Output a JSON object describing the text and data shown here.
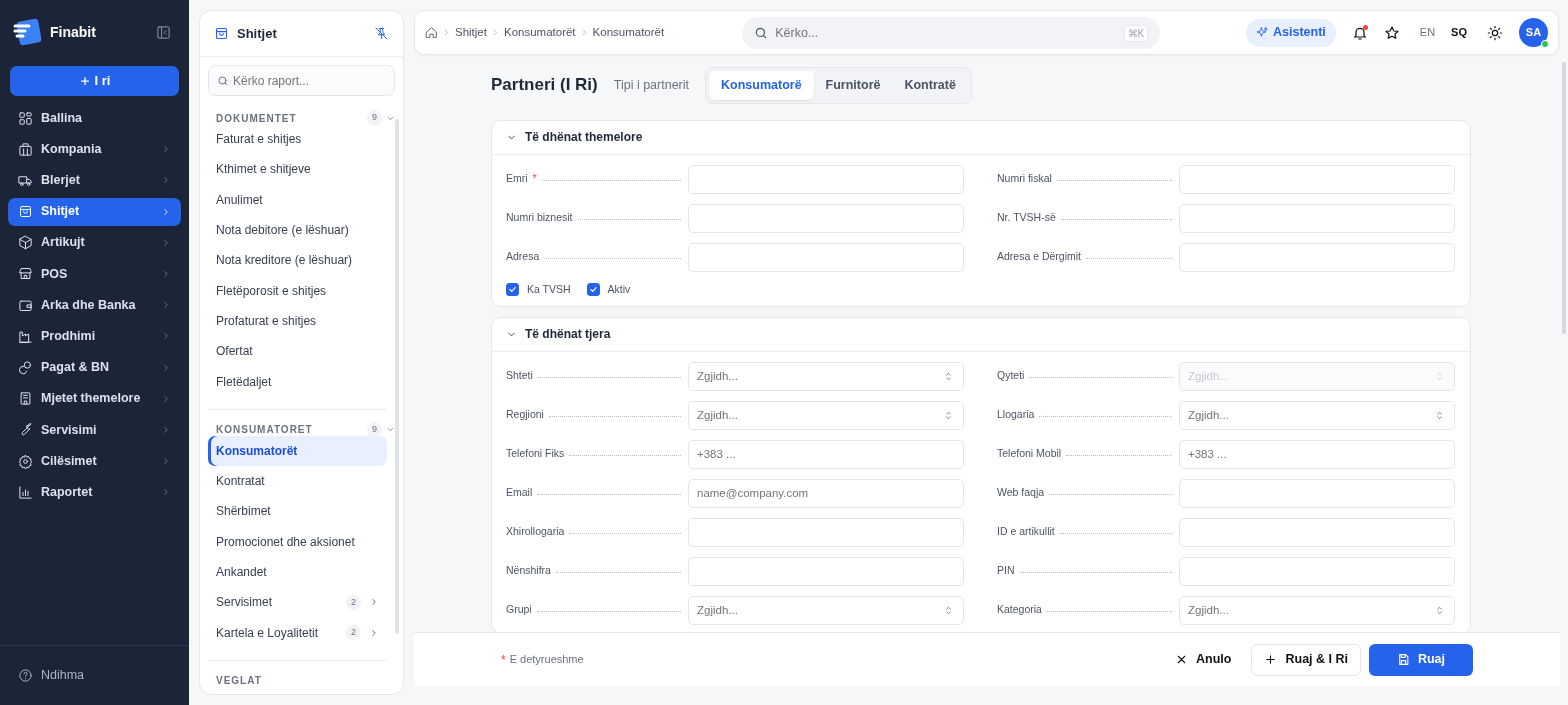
{
  "brand": {
    "name": "Finabit"
  },
  "new_button": {
    "label": "I ri"
  },
  "sidebar": {
    "items": [
      {
        "label": "Ballina",
        "selected": false,
        "has_submenu": false
      },
      {
        "label": "Kompania",
        "selected": false,
        "has_submenu": true
      },
      {
        "label": "Blerjet",
        "selected": false,
        "has_submenu": true
      },
      {
        "label": "Shitjet",
        "selected": true,
        "has_submenu": true
      },
      {
        "label": "Artikujt",
        "selected": false,
        "has_submenu": true
      },
      {
        "label": "POS",
        "selected": false,
        "has_submenu": true
      },
      {
        "label": "Arka dhe Banka",
        "selected": false,
        "has_submenu": true
      },
      {
        "label": "Prodhimi",
        "selected": false,
        "has_submenu": true
      },
      {
        "label": "Pagat & BN",
        "selected": false,
        "has_submenu": true
      },
      {
        "label": "Mjetet themelore",
        "selected": false,
        "has_submenu": true
      },
      {
        "label": "Servisimi",
        "selected": false,
        "has_submenu": true
      },
      {
        "label": "Cilësimet",
        "selected": false,
        "has_submenu": true
      },
      {
        "label": "Raportet",
        "selected": false,
        "has_submenu": true
      }
    ],
    "help": {
      "label": "Ndihma"
    }
  },
  "module_panel": {
    "title": "Shitjet",
    "search": {
      "placeholder": "Kërko raport..."
    },
    "sections": [
      {
        "title": "DOKUMENTET",
        "count": "9",
        "expanded": true,
        "items": [
          {
            "label": "Faturat e shitjes",
            "selected": false
          },
          {
            "label": "Kthimet e shitjeve",
            "selected": false
          },
          {
            "label": "Anulimet",
            "selected": false
          },
          {
            "label": "Nota debitore (e lëshuar)",
            "selected": false
          },
          {
            "label": "Nota kreditore (e lëshuar)",
            "selected": false
          },
          {
            "label": "Fletëporosit e shitjes",
            "selected": false
          },
          {
            "label": "Profaturat e shitjes",
            "selected": false
          },
          {
            "label": "Ofertat",
            "selected": false
          },
          {
            "label": "Fletëdaljet",
            "selected": false
          }
        ]
      },
      {
        "title": "KONSUMATORET",
        "count": "9",
        "expanded": true,
        "items": [
          {
            "label": "Konsumatorët",
            "selected": true
          },
          {
            "label": "Kontratat",
            "selected": false
          },
          {
            "label": "Shërbimet",
            "selected": false
          },
          {
            "label": "Promocionet dhe aksionet",
            "selected": false
          },
          {
            "label": "Ankandet",
            "selected": false
          },
          {
            "label": "Servisimet",
            "selected": false,
            "count": "2"
          },
          {
            "label": "Kartela e Loyalitetit",
            "selected": false,
            "count": "2"
          }
        ]
      },
      {
        "title": "VEGLAT"
      }
    ]
  },
  "topbar": {
    "breadcrumb": [
      "Shitjet",
      "Konsumatorët",
      "Konsumatorët"
    ],
    "search": {
      "placeholder": "Kërko...",
      "shortcut": "⌘K"
    },
    "assistant": "Asistenti",
    "has_unread_notifications": true,
    "languages": [
      {
        "label": "EN",
        "selected": false
      },
      {
        "label": "SQ",
        "selected": true
      }
    ],
    "avatar": {
      "initials": "SA",
      "online": true
    }
  },
  "page": {
    "title": "Partneri (I Ri)",
    "type_label": "Tipi i partnerit",
    "type_tabs": [
      {
        "label": "Konsumatorë",
        "selected": true
      },
      {
        "label": "Furnitorë",
        "selected": false
      },
      {
        "label": "Kontratë",
        "selected": false
      }
    ],
    "sections": [
      {
        "title": "Të dhënat themelore",
        "expanded": true,
        "fields": [
          {
            "label": "Emri",
            "kind": "text",
            "required": true
          },
          {
            "label": "Numri fiskal",
            "kind": "text",
            "required": false
          },
          {
            "label": "Numri biznesit",
            "kind": "text",
            "required": false
          },
          {
            "label": "Nr. TVSH-së",
            "kind": "text",
            "required": false
          },
          {
            "label": "Adresa",
            "kind": "text",
            "required": false
          },
          {
            "label": "Adresa e Dërgimit",
            "kind": "text",
            "required": false
          }
        ],
        "checkboxes": [
          {
            "label": "Ka TVSH",
            "checked": true
          },
          {
            "label": "Aktiv",
            "checked": true
          }
        ]
      },
      {
        "title": "Të dhënat tjera",
        "expanded": true,
        "fields": [
          {
            "label": "Shteti",
            "kind": "select",
            "placeholder": "Zgjidh..."
          },
          {
            "label": "Qyteti",
            "kind": "select",
            "placeholder": "Zgjidh...",
            "disabled": true
          },
          {
            "label": "Regjioni",
            "kind": "select",
            "placeholder": "Zgjidh..."
          },
          {
            "label": "Llogaria",
            "kind": "select",
            "placeholder": "Zgjidh..."
          },
          {
            "label": "Telefoni Fiks",
            "kind": "text",
            "placeholder": "+383 ..."
          },
          {
            "label": "Telefoni Mobil",
            "kind": "text",
            "placeholder": "+383 ..."
          },
          {
            "label": "Email",
            "kind": "text",
            "placeholder": "name@company.com"
          },
          {
            "label": "Web faqja",
            "kind": "text"
          },
          {
            "label": "Xhirollogaria",
            "kind": "text"
          },
          {
            "label": "ID e artikullit",
            "kind": "text"
          },
          {
            "label": "Nënshifra",
            "kind": "text"
          },
          {
            "label": "PIN",
            "kind": "text"
          },
          {
            "label": "Grupi",
            "kind": "select",
            "placeholder": "Zgjidh..."
          },
          {
            "label": "Kategoria",
            "kind": "select",
            "placeholder": "Zgjidh..."
          }
        ]
      }
    ]
  },
  "footer": {
    "required_mark": "*",
    "required_note": "E detyrueshme",
    "buttons": [
      {
        "kind": "cancel",
        "label": "Anulo"
      },
      {
        "kind": "save_new",
        "label": "Ruaj & I Ri"
      },
      {
        "kind": "save",
        "label": "Ruaj"
      }
    ]
  }
}
